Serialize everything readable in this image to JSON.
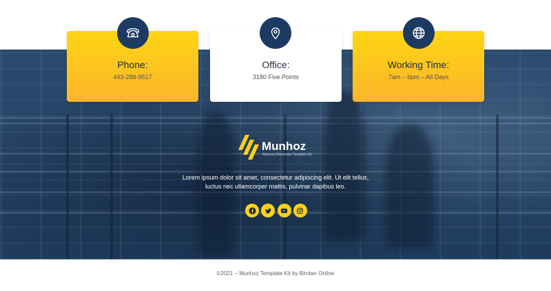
{
  "cards": [
    {
      "title": "Phone:",
      "value": "443-288-9517",
      "icon": "phone-icon",
      "style": "yellow"
    },
    {
      "title": "Office:",
      "value": "3180 Five Points",
      "icon": "location-pin-icon",
      "style": "white"
    },
    {
      "title": "Working Time:",
      "value": "7am – 6pm – All Days",
      "icon": "globe-icon",
      "style": "yellow"
    }
  ],
  "logo": {
    "name": "Munhoz",
    "tagline": "Attorney Elementor Template Kit",
    "icon": "munhoz-logo-icon"
  },
  "blurb": "Lorem ipsum dolor sit amet, consectetur adipiscing elit. Ut elit tellus, luctus nec ullamcorper mattis, pulvinar dapibus leo.",
  "social": [
    {
      "icon": "facebook-icon"
    },
    {
      "icon": "twitter-icon"
    },
    {
      "icon": "youtube-icon"
    },
    {
      "icon": "instagram-icon"
    }
  ],
  "copyright": "©2021 – Munhoz Template Kit by Bimber Online",
  "colors": {
    "accent_yellow": "#ffd512",
    "accent_orange": "#fcb52c",
    "navy": "#1d3a63",
    "hero_blue": "#274568"
  }
}
